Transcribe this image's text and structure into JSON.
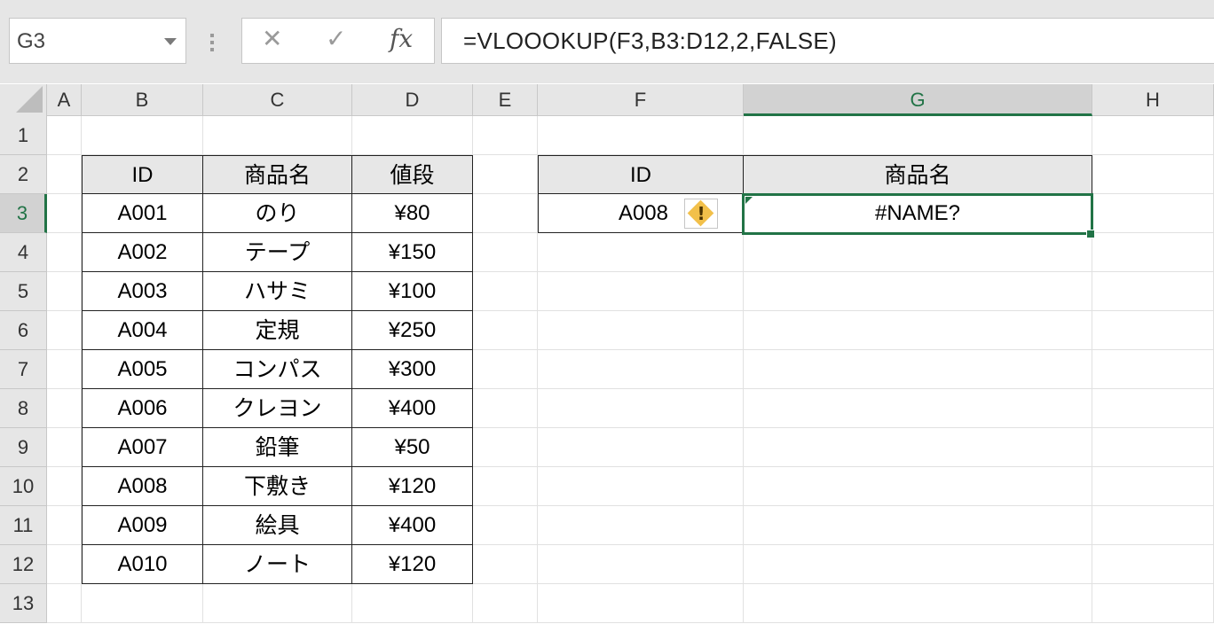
{
  "formula_bar": {
    "name_box": "G3",
    "cancel_glyph": "✕",
    "enter_glyph": "✓",
    "fx_label": "fx",
    "formula": "=VLOOOKUP(F3,B3:D12,2,FALSE)"
  },
  "columns": [
    "A",
    "B",
    "C",
    "D",
    "E",
    "F",
    "G",
    "H"
  ],
  "active_column": "G",
  "rows": [
    "1",
    "2",
    "3",
    "4",
    "5",
    "6",
    "7",
    "8",
    "9",
    "10",
    "11",
    "12",
    "13"
  ],
  "active_row": "3",
  "product_table": {
    "headers": {
      "id": "ID",
      "name": "商品名",
      "price": "値段"
    },
    "items": [
      {
        "id": "A001",
        "name": "のり",
        "price": "¥80"
      },
      {
        "id": "A002",
        "name": "テープ",
        "price": "¥150"
      },
      {
        "id": "A003",
        "name": "ハサミ",
        "price": "¥100"
      },
      {
        "id": "A004",
        "name": "定規",
        "price": "¥250"
      },
      {
        "id": "A005",
        "name": "コンパス",
        "price": "¥300"
      },
      {
        "id": "A006",
        "name": "クレヨン",
        "price": "¥400"
      },
      {
        "id": "A007",
        "name": "鉛筆",
        "price": "¥50"
      },
      {
        "id": "A008",
        "name": "下敷き",
        "price": "¥120"
      },
      {
        "id": "A009",
        "name": "絵具",
        "price": "¥400"
      },
      {
        "id": "A010",
        "name": "ノート",
        "price": "¥120"
      }
    ]
  },
  "lookup_table": {
    "headers": {
      "id": "ID",
      "name": "商品名"
    },
    "id_value": "A008",
    "result_value": "#NAME?",
    "error_icon": "warning-diamond",
    "error_glyph": "!"
  },
  "colors": {
    "accent": "#217346",
    "warning": "#f2c04a",
    "header_fill": "#e7e7e7"
  }
}
